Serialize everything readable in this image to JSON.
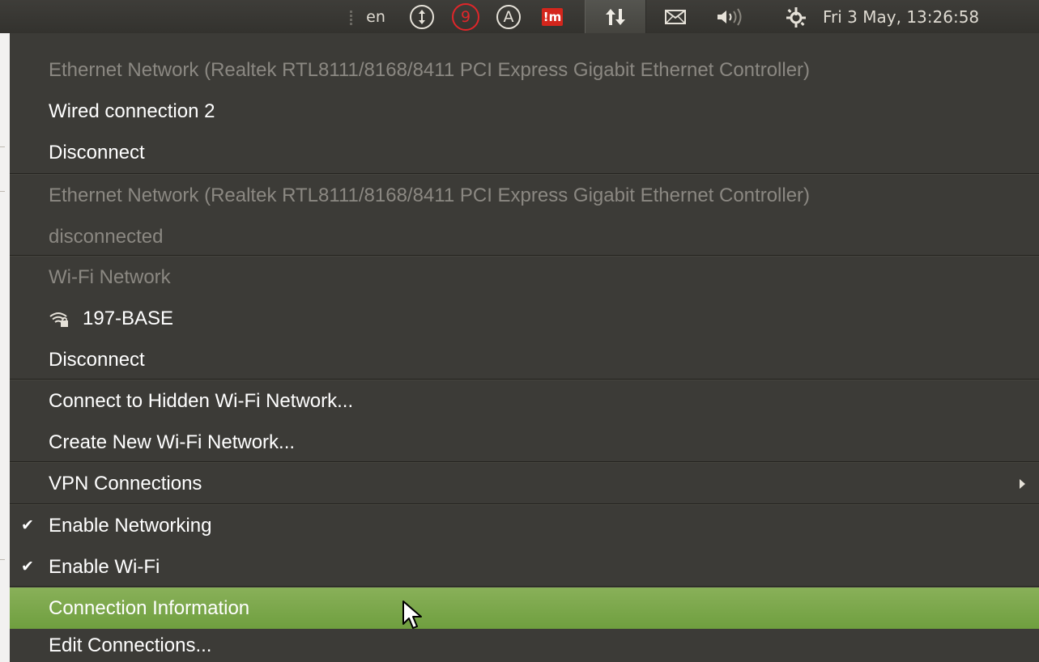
{
  "panel": {
    "language": "en",
    "notification_count": "9",
    "accessibility_letter": "A",
    "antivirus_label": "!m",
    "clock": "Fri  3 May, 13:26:58"
  },
  "icons": {
    "indicator_1": "up-down-arrow-icon",
    "indicator_2": "notification-count-icon",
    "indicator_3": "keyboard-a-icon",
    "indicator_4": "mcafee-icon",
    "network": "network-transfer-icon",
    "mail": "envelope-icon",
    "sound": "speaker-icon",
    "session": "gear-icon"
  },
  "colors": {
    "panel_bg": "#3c3b37",
    "menu_bg": "#3c3b37",
    "highlight": "#7aa84a",
    "disabled_text": "#8b8882",
    "notification_red": "#e0262a"
  },
  "menu": {
    "ethernet1_header": "Ethernet Network (Realtek RTL8111/8168/8411 PCI Express Gigabit Ethernet Controller)",
    "wired_connection": "Wired connection 2",
    "disconnect_wired": "Disconnect",
    "ethernet2_header": "Ethernet Network (Realtek RTL8111/8168/8411 PCI Express Gigabit Ethernet Controller)",
    "ethernet2_status": "disconnected",
    "wifi_header": "Wi-Fi Network",
    "wifi_network": "197-BASE",
    "disconnect_wifi": "Disconnect",
    "connect_hidden": "Connect to Hidden Wi-Fi Network...",
    "create_new": "Create New Wi-Fi Network...",
    "vpn": "VPN Connections",
    "enable_networking": "Enable Networking",
    "enable_wifi": "Enable Wi-Fi",
    "connection_info": "Connection Information",
    "edit_connections": "Edit Connections..."
  }
}
